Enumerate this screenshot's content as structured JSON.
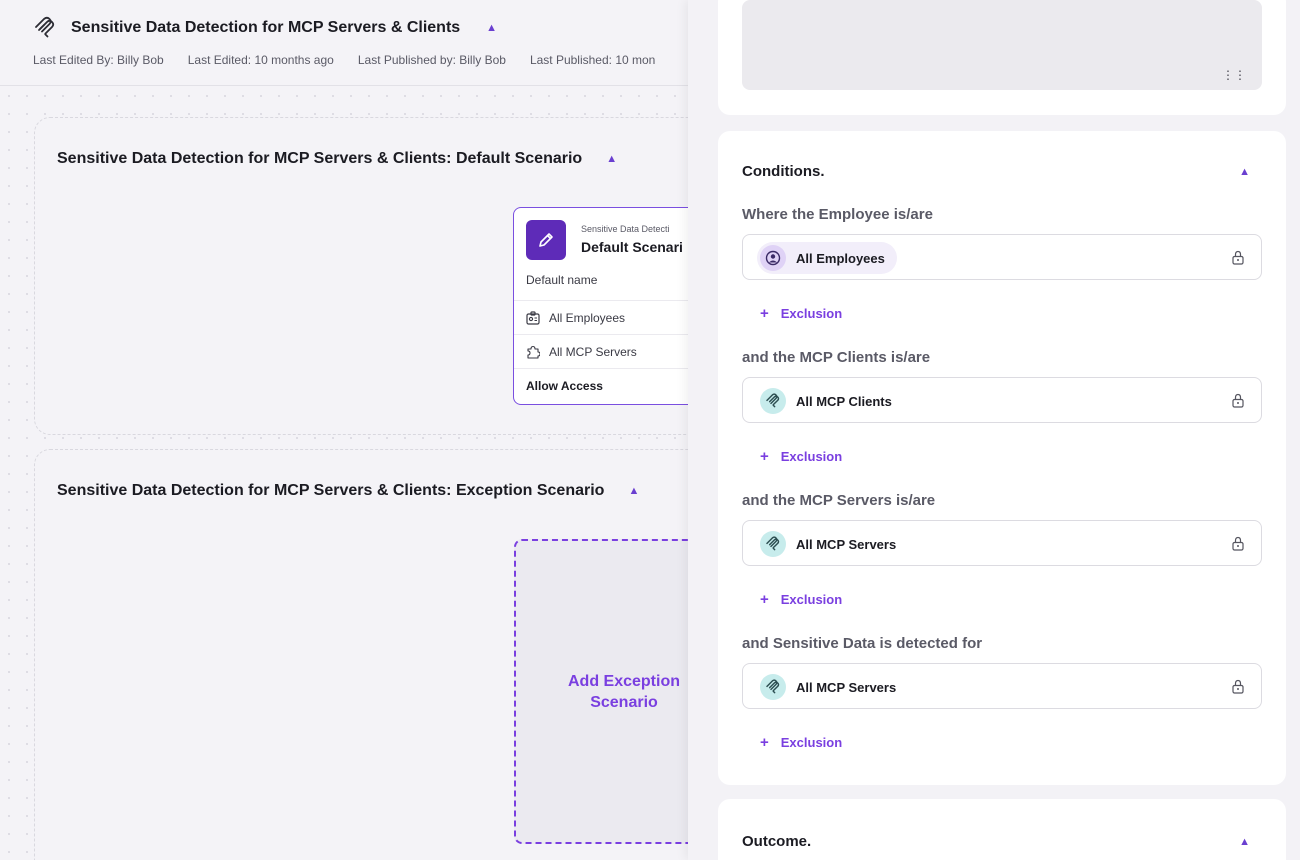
{
  "header": {
    "title": "Sensitive Data Detection for MCP Servers & Clients",
    "last_edited_by": "Last Edited By: Billy Bob",
    "last_edited": "Last Edited: 10 months ago",
    "last_published_by": "Last Published by: Billy Bob",
    "last_published": "Last Published: 10 mon"
  },
  "canvas": {
    "default_scenario_title": "Sensitive Data Detection for MCP Servers & Clients: Default Scenario",
    "exception_scenario_title": "Sensitive Data Detection for MCP Servers & Clients: Exception Scenario",
    "card": {
      "subtitle": "Sensitive Data Detecti",
      "title": "Default Scenari",
      "description": "Default name",
      "employees": "All Employees",
      "servers": "All MCP Servers",
      "outcome": "Allow Access"
    },
    "add_exception_label": "Add Exception Scenario"
  },
  "panel": {
    "conditions": {
      "heading": "Conditions.",
      "groups": [
        {
          "label": "Where the Employee is/are",
          "value": "All Employees",
          "exclusion": "Exclusion"
        },
        {
          "label": "and the MCP Clients is/are",
          "value": "All MCP Clients",
          "exclusion": "Exclusion"
        },
        {
          "label": "and the MCP Servers is/are",
          "value": "All MCP Servers",
          "exclusion": "Exclusion"
        },
        {
          "label": "and Sensitive Data is detected for",
          "value": "All MCP Servers",
          "exclusion": "Exclusion"
        }
      ]
    },
    "outcome": {
      "heading": "Outcome."
    }
  },
  "icons": {
    "logo": "mcp-logo-icon",
    "caret": "chevron-up-icon",
    "edit": "pencil-icon",
    "lock": "lock-icon",
    "grip": "grip-icon"
  },
  "colors": {
    "accent": "#7a3fe0",
    "card_icon_bg": "#5e2bb8",
    "teal_chip": "#c7ecec",
    "purple_chip": "#dfd2f6"
  }
}
